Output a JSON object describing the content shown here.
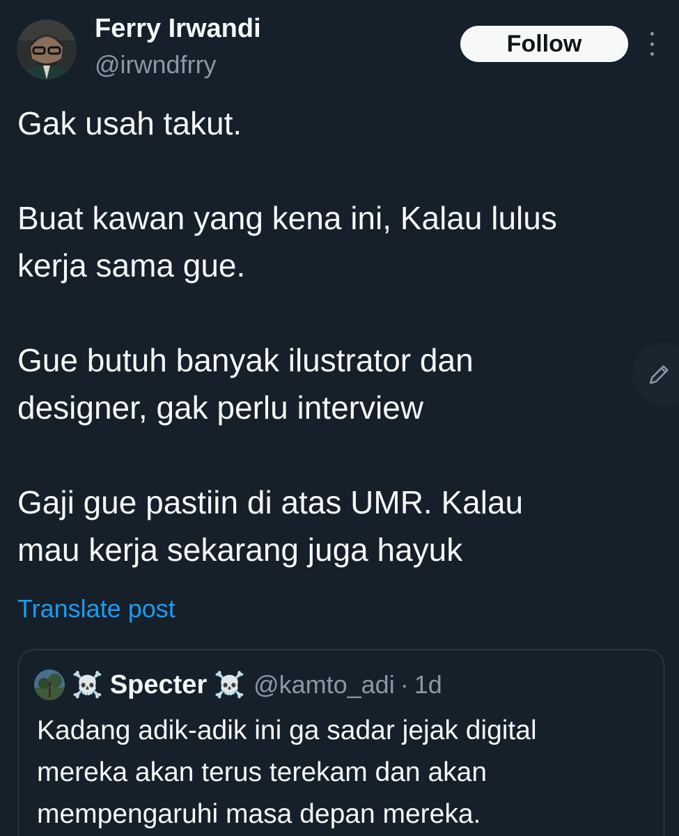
{
  "author": {
    "display_name": "Ferry Irwandi",
    "handle": "@irwndfrry"
  },
  "follow_button": {
    "label": "Follow"
  },
  "post": {
    "paragraphs": [
      [
        "Gak usah takut."
      ],
      [
        "Buat kawan yang kena ini, Kalau lulus",
        "kerja sama gue."
      ],
      [
        "Gue butuh banyak ilustrator dan",
        "designer, gak perlu interview"
      ],
      [
        "Gaji gue pastiin di atas UMR. Kalau",
        "mau kerja sekarang juga hayuk"
      ]
    ],
    "translate_label": "Translate post"
  },
  "quoted_post": {
    "name_prefix_emoji": "☠️",
    "display_name": "Specter",
    "name_suffix_emoji": "☠️",
    "handle": "@kamto_adi",
    "separator": "·",
    "time": "1d",
    "lines": [
      "Kadang adik-adik ini ga sadar jejak digital",
      "mereka akan terus terekam dan akan",
      "mempengaruhi masa depan mereka."
    ]
  },
  "icons": {
    "more": "more-vertical-icon",
    "compose": "pencil-icon"
  },
  "colors": {
    "background": "#15202b",
    "accent": "#1d9bf0",
    "text_primary": "#f7f9f9",
    "text_secondary": "#8b98a5",
    "border": "#38444d"
  }
}
